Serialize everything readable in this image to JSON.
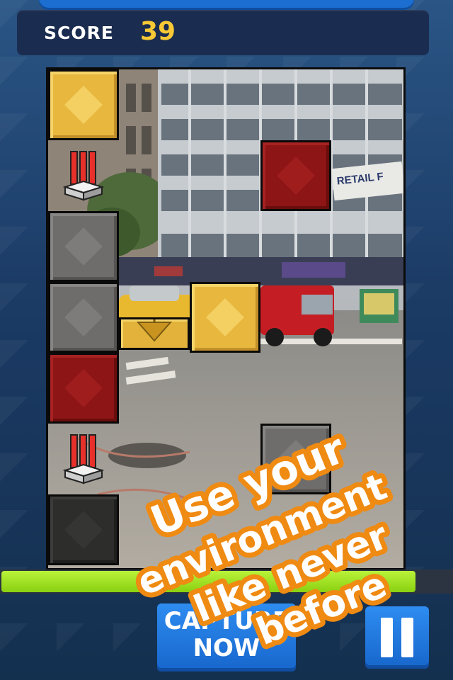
{
  "score": {
    "label": "SCORE",
    "value": "39"
  },
  "level_progress": 0.92,
  "buttons": {
    "capture_line1": "CAPTURE",
    "capture_line2": "NOW",
    "pause_icon": "pause-icon"
  },
  "promo": {
    "line1": "Use your",
    "line2": "environment",
    "line3": "like never",
    "line4": "before"
  },
  "board": {
    "blocks": [
      {
        "col": 0,
        "row": 0,
        "type": "yellow"
      },
      {
        "col": 3,
        "row": 1,
        "type": "red"
      },
      {
        "col": 0,
        "row": 2,
        "type": "gray"
      },
      {
        "col": 0,
        "row": 3,
        "type": "gray"
      },
      {
        "col": 2,
        "row": 3,
        "type": "yellow"
      },
      {
        "col": 0,
        "row": 4,
        "type": "red"
      },
      {
        "col": 3,
        "row": 5,
        "type": "gray"
      },
      {
        "col": 0,
        "row": 6,
        "type": "dark"
      }
    ],
    "powerups": [
      {
        "col": 0,
        "row": 1,
        "icon": "dynamite-icon"
      },
      {
        "col": 0,
        "row": 5,
        "icon": "dynamite-icon"
      }
    ],
    "sign_text": "RETAIL F"
  },
  "colors": {
    "score_value": "#f8c935",
    "progress": "#a6e21f",
    "button": "#1e74d8",
    "promo_outline": "#ef8a12"
  }
}
